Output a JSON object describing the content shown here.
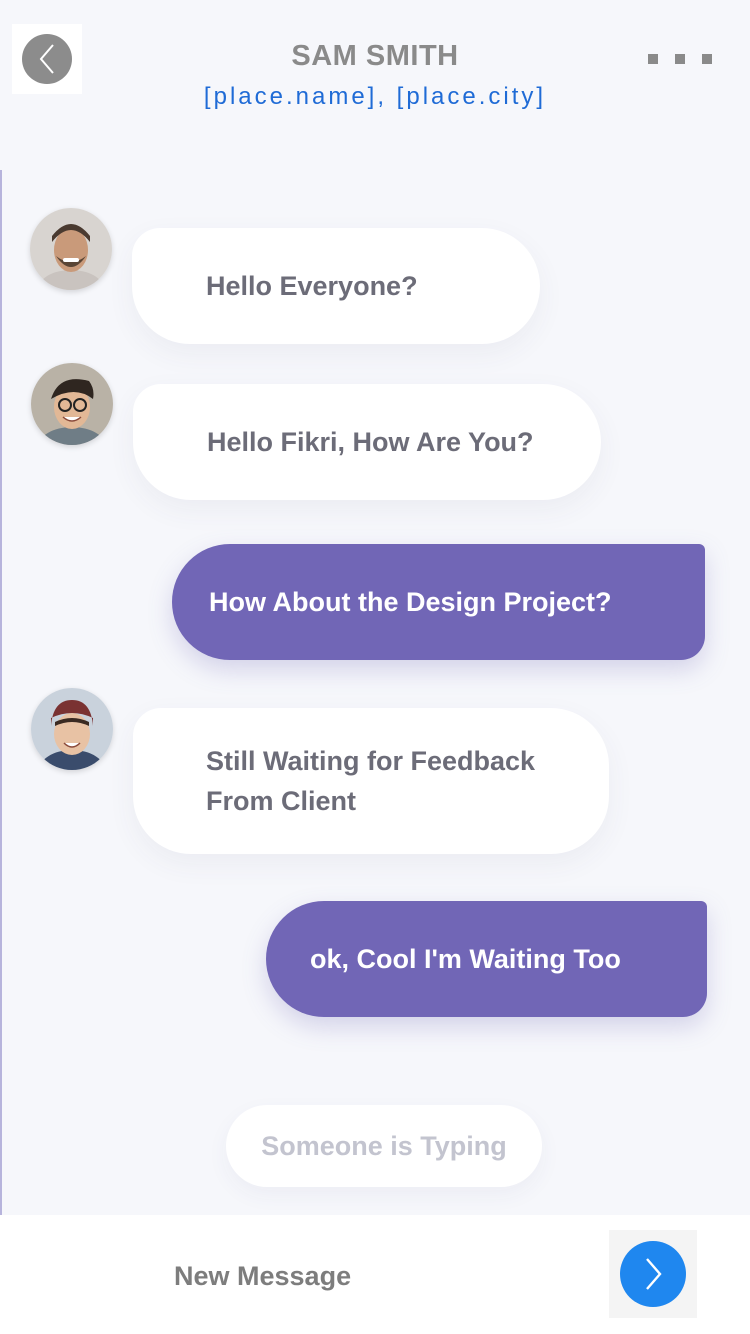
{
  "header": {
    "title": "SAM SMITH",
    "location": "[place.name], [place.city]"
  },
  "messages": [
    {
      "text": "Hello Everyone?",
      "direction": "incoming"
    },
    {
      "text": "Hello Fikri, How Are You?",
      "direction": "incoming"
    },
    {
      "text": "How About the Design Project?",
      "direction": "outgoing"
    },
    {
      "text": "Still Waiting for Feedback From Client",
      "direction": "incoming"
    },
    {
      "text": "ok, Cool I'm Waiting Too",
      "direction": "outgoing"
    }
  ],
  "typing_indicator": "Someone is Typing",
  "composer": {
    "placeholder": "New Message"
  },
  "icons": {
    "back": "chevron-left-icon",
    "more": "more-dots-icon",
    "send": "chevron-right-icon"
  },
  "colors": {
    "accent": "#7166b6",
    "send": "#1f87ef",
    "location": "#1f6bd6"
  }
}
